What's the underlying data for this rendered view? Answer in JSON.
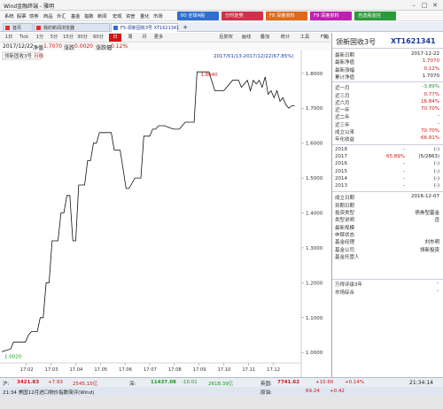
{
  "window": {
    "title": "Wind金融终端 - 雅明",
    "min": "–",
    "max": "□",
    "close": "✕"
  },
  "menu": {
    "items": [
      "系统",
      "股票",
      "债券",
      "商品",
      "外汇",
      "基金",
      "指数",
      "新闻",
      "宏观",
      "资管",
      "量化",
      "市场"
    ]
  },
  "quick_buttons": [
    {
      "label": "60 全球A股",
      "color": "#2f6fd0"
    },
    {
      "label": "分时走势",
      "color": "#d0304a"
    },
    {
      "label": "F8 深度资料",
      "color": "#e06a1b"
    },
    {
      "label": "F9 深度资料",
      "color": "#c020b0"
    },
    {
      "label": "自选股监控",
      "color": "#2a9a3a"
    }
  ],
  "tabs": [
    {
      "label": "首页",
      "active": false
    },
    {
      "label": "我的新闻浏览器",
      "active": false
    },
    {
      "label": "F5-领新固收3号 XT1621341",
      "active": true
    }
  ],
  "tab_add": "+",
  "toolbar": {
    "left": [
      "1日",
      "Tick",
      "1分",
      "5分",
      "15分",
      "30分",
      "60分",
      "日",
      "周",
      "月",
      "更多"
    ],
    "right": [
      "后复权",
      "画线",
      "叠加",
      "统计",
      "工具",
      "F9",
      "指标▾"
    ],
    "active": "日"
  },
  "info_bar": {
    "date": "2017/12/22",
    "net_label": "净值",
    "net_value": "1.7070",
    "chg_label": "涨跌",
    "chg_value": "0.0020",
    "pct_label": "涨跌幅",
    "pct_value": "0.12%"
  },
  "legend": {
    "series": "领新固收3号",
    "scale_label": "日线"
  },
  "chart_data": {
    "type": "line",
    "range_label": "2017/01/13-2017/12/22(67.85%)",
    "annotations": {
      "min_label": "1.0020",
      "max_label": "1.8040"
    },
    "y_ticks": [
      "1.8000",
      "1.7000",
      "1.6000",
      "1.5000",
      "1.4000",
      "1.3000",
      "1.2000",
      "1.1000",
      "1.0000"
    ],
    "x_ticks": [
      "17.02",
      "17.03",
      "17.04",
      "17.05",
      "17.06",
      "17.07",
      "17.08",
      "17.09",
      "17.10",
      "17.11",
      "17.12"
    ],
    "ylim": [
      0.97,
      1.83
    ],
    "xlim": [
      0,
      100
    ],
    "x": [
      0,
      1,
      3,
      4,
      8,
      9,
      10,
      12,
      13,
      14,
      15,
      16,
      17,
      19,
      20,
      21,
      22,
      23,
      24,
      25,
      26,
      28,
      29,
      30,
      31,
      32,
      33,
      34,
      36,
      37,
      38,
      39,
      40,
      42,
      43,
      45,
      47,
      48,
      50,
      51,
      52,
      53,
      55,
      58,
      60,
      62,
      65,
      66,
      70,
      72,
      75,
      78,
      80,
      81,
      82,
      83,
      84,
      85,
      86,
      87,
      88,
      89,
      90,
      91,
      92,
      93,
      94,
      95,
      96,
      97,
      98,
      99
    ],
    "values": [
      1.002,
      1.005,
      1.01,
      1.03,
      1.03,
      1.05,
      1.06,
      1.06,
      1.1,
      1.1,
      1.2,
      1.2,
      1.32,
      1.32,
      1.4,
      1.4,
      1.45,
      1.45,
      1.32,
      1.32,
      1.48,
      1.48,
      1.55,
      1.55,
      1.6,
      1.6,
      1.63,
      1.63,
      1.63,
      1.63,
      1.58,
      1.58,
      1.58,
      1.47,
      1.47,
      1.5,
      1.5,
      1.62,
      1.62,
      1.64,
      1.64,
      1.65,
      1.65,
      1.64,
      1.64,
      1.66,
      1.66,
      1.804,
      1.804,
      1.75,
      1.75,
      1.78,
      1.78,
      1.76,
      1.77,
      1.78,
      1.75,
      1.78,
      1.77,
      1.78,
      1.76,
      1.79,
      1.74,
      1.75,
      1.73,
      1.75,
      1.72,
      1.73,
      1.71,
      1.7,
      1.707,
      1.707
    ]
  },
  "panel": {
    "name": "领新固收3号",
    "code": "XT1621341",
    "stats": [
      {
        "label": "最新日期",
        "value": "2017-12-22",
        "tone": "black"
      },
      {
        "label": "最新净值",
        "value": "1.7070",
        "tone": "red"
      },
      {
        "label": "最新涨幅",
        "value": "0.12%",
        "tone": "red"
      },
      {
        "label": "累计净值",
        "value": "1.7070",
        "tone": "black"
      }
    ],
    "returns": [
      {
        "label": "近一月",
        "value": "-3.89%",
        "tone": "green"
      },
      {
        "label": "近三月",
        "value": "0.77%",
        "tone": "red"
      },
      {
        "label": "近六月",
        "value": "16.84%",
        "tone": "red"
      },
      {
        "label": "近一年",
        "value": "70.70%",
        "tone": "red"
      },
      {
        "label": "近二年",
        "value": "-",
        "tone": "black"
      },
      {
        "label": "近三年",
        "value": "-",
        "tone": "black"
      },
      {
        "label": "成立以来",
        "value": "70.70%",
        "tone": "red"
      },
      {
        "label": "年化收益",
        "value": "66.91%",
        "tone": "red"
      }
    ],
    "years": [
      {
        "year": "2018",
        "pct": "-",
        "rank": "(-)",
        "tone": "black"
      },
      {
        "year": "2017",
        "pct": "65.89%",
        "rank": "(5/2863)",
        "tone": "red"
      },
      {
        "year": "2016",
        "pct": "-",
        "rank": "(-)",
        "tone": "black"
      },
      {
        "year": "2015",
        "pct": "-",
        "rank": "(-)",
        "tone": "black"
      },
      {
        "year": "2014",
        "pct": "-",
        "rank": "(-)",
        "tone": "black"
      },
      {
        "year": "2013",
        "pct": "-",
        "rank": "(-)",
        "tone": "black"
      }
    ],
    "info": [
      {
        "label": "成立日期",
        "value": "2016-12-07"
      },
      {
        "label": "到期日期",
        "value": ""
      },
      {
        "label": "投资类型",
        "value": "债券型基金"
      },
      {
        "label": "类型说明",
        "value": "否"
      },
      {
        "label": "最新规模",
        "value": ""
      },
      {
        "label": "申赎状态",
        "value": ""
      },
      {
        "label": "基金经理",
        "value": "刘东明"
      },
      {
        "label": "基金公司",
        "value": "领新投资"
      },
      {
        "label": "基金托管人",
        "value": ""
      }
    ],
    "rating_label": "万得评级3年",
    "rating_value": "-",
    "overall_label": "市场综合",
    "overall_value": "-"
  },
  "status": {
    "sh_label": "沪:",
    "sh_value": "3421.83",
    "sh_chg": "+7.93",
    "sh_amt": "2545.15亿",
    "sz_label": "深:",
    "sz_value": "11437.08",
    "sz_chg": "-10.01",
    "sz_amt": "2618.39亿",
    "uk_label": "英国:",
    "uk_value": "7741.62",
    "uk_chg": "+10.60",
    "uk_pct": "+0.14%",
    "time": "21:34:14"
  },
  "news": {
    "text": "21:34 美国12月进口物价指数简评(Wind)",
    "market_label": "原油:",
    "v1": "69.24",
    "v2": "+0.42"
  }
}
